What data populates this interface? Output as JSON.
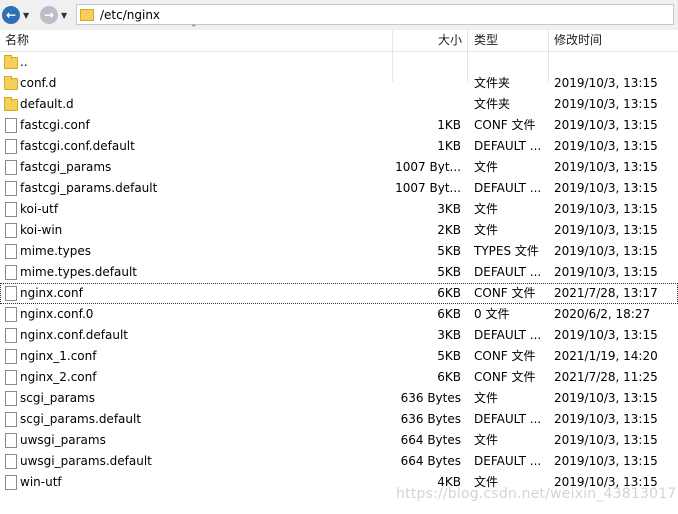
{
  "toolbar": {
    "back_icon": "back-arrow-icon",
    "forward_icon": "forward-arrow-icon",
    "address_path": "/etc/nginx"
  },
  "columns": {
    "name": "名称",
    "size": "大小",
    "type": "类型",
    "modified": "修改时间"
  },
  "files": [
    {
      "name": "..",
      "size": "",
      "type": "",
      "modified": "",
      "icon": "folder"
    },
    {
      "name": "conf.d",
      "size": "",
      "type": "文件夹",
      "modified": "2019/10/3, 13:15",
      "icon": "folder"
    },
    {
      "name": "default.d",
      "size": "",
      "type": "文件夹",
      "modified": "2019/10/3, 13:15",
      "icon": "folder"
    },
    {
      "name": "fastcgi.conf",
      "size": "1KB",
      "type": "CONF 文件",
      "modified": "2019/10/3, 13:15",
      "icon": "file"
    },
    {
      "name": "fastcgi.conf.default",
      "size": "1KB",
      "type": "DEFAULT ...",
      "modified": "2019/10/3, 13:15",
      "icon": "file"
    },
    {
      "name": "fastcgi_params",
      "size": "1007 Byt...",
      "type": "文件",
      "modified": "2019/10/3, 13:15",
      "icon": "file"
    },
    {
      "name": "fastcgi_params.default",
      "size": "1007 Byt...",
      "type": "DEFAULT ...",
      "modified": "2019/10/3, 13:15",
      "icon": "file"
    },
    {
      "name": "koi-utf",
      "size": "3KB",
      "type": "文件",
      "modified": "2019/10/3, 13:15",
      "icon": "file"
    },
    {
      "name": "koi-win",
      "size": "2KB",
      "type": "文件",
      "modified": "2019/10/3, 13:15",
      "icon": "file"
    },
    {
      "name": "mime.types",
      "size": "5KB",
      "type": "TYPES 文件",
      "modified": "2019/10/3, 13:15",
      "icon": "file"
    },
    {
      "name": "mime.types.default",
      "size": "5KB",
      "type": "DEFAULT ...",
      "modified": "2019/10/3, 13:15",
      "icon": "file"
    },
    {
      "name": "nginx.conf",
      "size": "6KB",
      "type": "CONF 文件",
      "modified": "2021/7/28, 13:17",
      "icon": "file",
      "focused": true
    },
    {
      "name": "nginx.conf.0",
      "size": "6KB",
      "type": "0 文件",
      "modified": "2020/6/2, 18:27",
      "icon": "file"
    },
    {
      "name": "nginx.conf.default",
      "size": "3KB",
      "type": "DEFAULT ...",
      "modified": "2019/10/3, 13:15",
      "icon": "file"
    },
    {
      "name": "nginx_1.conf",
      "size": "5KB",
      "type": "CONF 文件",
      "modified": "2021/1/19, 14:20",
      "icon": "file"
    },
    {
      "name": "nginx_2.conf",
      "size": "6KB",
      "type": "CONF 文件",
      "modified": "2021/7/28, 11:25",
      "icon": "file"
    },
    {
      "name": "scgi_params",
      "size": "636 Bytes",
      "type": "文件",
      "modified": "2019/10/3, 13:15",
      "icon": "file"
    },
    {
      "name": "scgi_params.default",
      "size": "636 Bytes",
      "type": "DEFAULT ...",
      "modified": "2019/10/3, 13:15",
      "icon": "file"
    },
    {
      "name": "uwsgi_params",
      "size": "664 Bytes",
      "type": "文件",
      "modified": "2019/10/3, 13:15",
      "icon": "file"
    },
    {
      "name": "uwsgi_params.default",
      "size": "664 Bytes",
      "type": "DEFAULT ...",
      "modified": "2019/10/3, 13:15",
      "icon": "file"
    },
    {
      "name": "win-utf",
      "size": "4KB",
      "type": "文件",
      "modified": "2019/10/3, 13:15",
      "icon": "file"
    }
  ],
  "watermark": "https://blog.csdn.net/weixin_43813017"
}
